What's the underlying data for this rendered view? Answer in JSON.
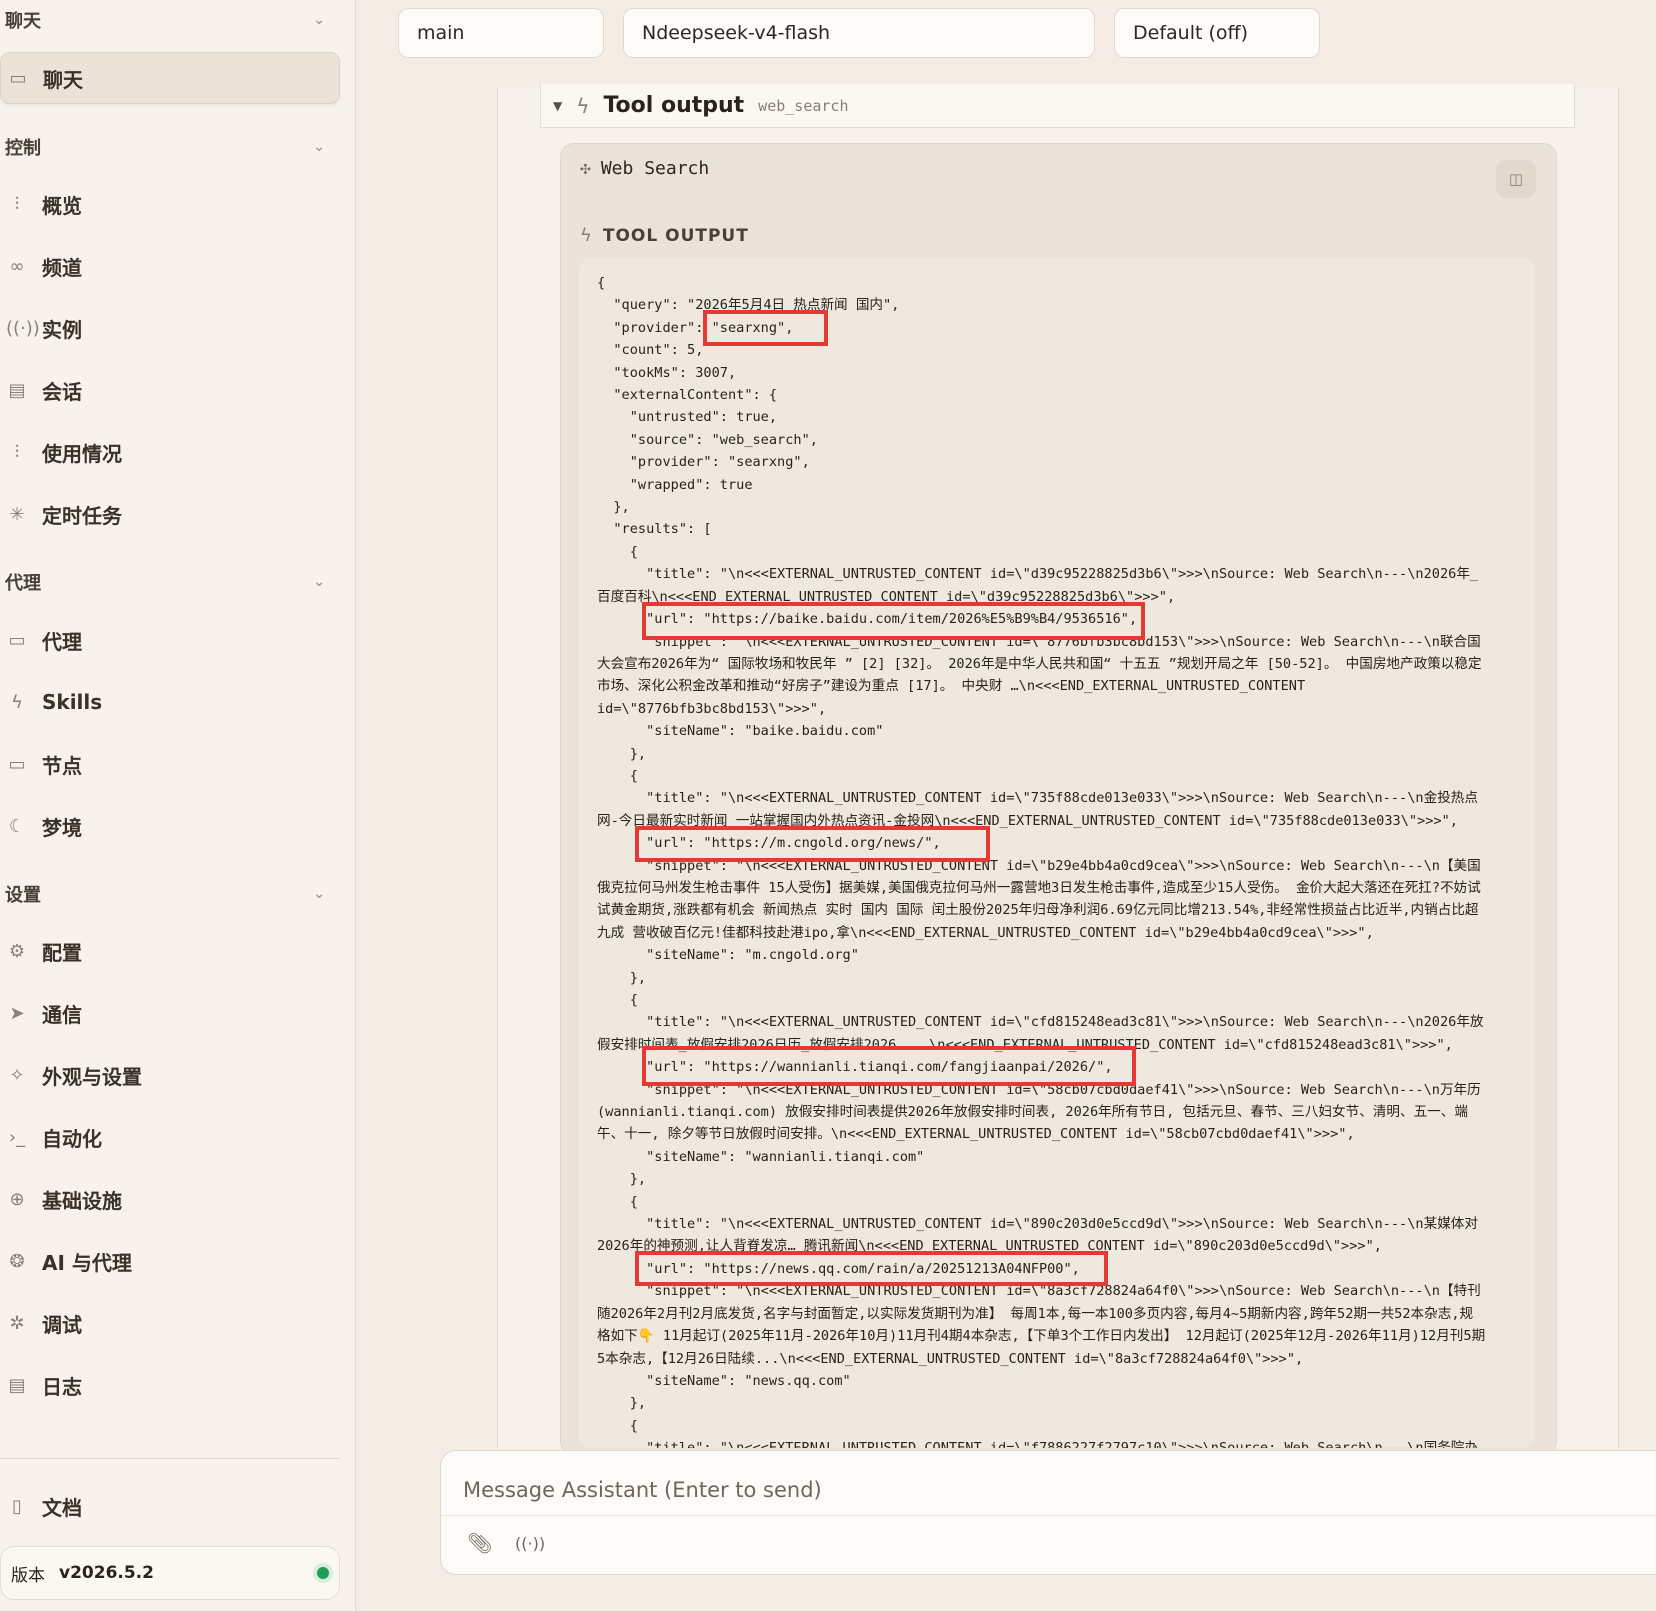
{
  "sidebar": {
    "sections": [
      {
        "title": "聊天"
      },
      {
        "title": "控制"
      },
      {
        "title": "代理"
      },
      {
        "title": "设置"
      }
    ],
    "chat_item": "聊天",
    "control_items": [
      "概览",
      "频道",
      "实例",
      "会话",
      "使用情况",
      "定时任务"
    ],
    "agent_items": [
      "代理",
      "Skills",
      "节点",
      "梦境"
    ],
    "settings_items": [
      "配置",
      "通信",
      "外观与设置",
      "自动化",
      "基础设施",
      "AI 与代理",
      "调试",
      "日志"
    ],
    "docs_item": "文档",
    "version_label": "版本",
    "version_value": "v2026.5.2",
    "status_color": "#1f9d55"
  },
  "top_selectors": {
    "agent": "main",
    "model": "Ndeepseek-v4-flash",
    "thinking": "Default (off)"
  },
  "tool_output": {
    "title": "Tool output",
    "tool_name": "web_search",
    "card_title": "Web Search",
    "section_label": "TOOL OUTPUT",
    "lines": [
      "{",
      "  \"query\": \"2026年5月4日 热点新闻 国内\",",
      "  \"provider\": \"searxng\",",
      "  \"count\": 5,",
      "  \"tookMs\": 3007,",
      "  \"externalContent\": {",
      "    \"untrusted\": true,",
      "    \"source\": \"web_search\",",
      "    \"provider\": \"searxng\",",
      "    \"wrapped\": true",
      "  },",
      "  \"results\": [",
      "    {",
      "      \"title\": \"\\n<<<EXTERNAL_UNTRUSTED_CONTENT id=\\\"d39c95228825d3b6\\\">>>\\nSource: Web Search\\n---\\n2026年_",
      "百度百科\\n<<<END_EXTERNAL_UNTRUSTED_CONTENT id=\\\"d39c95228825d3b6\\\">>>\",",
      "      \"url\": \"https://baike.baidu.com/item/2026%E5%B9%B4/9536516\",",
      "      \"snippet\": \"\\n<<<EXTERNAL_UNTRUSTED_CONTENT id=\\\"8776bfb3bc8bd153\\\">>>\\nSource: Web Search\\n---\\n联合国",
      "大会宣布2026年为“ 国际牧场和牧民年 ” [2] [32]。 2026年是中华人民共和国“ 十五五 ”规划开局之年 [50-52]。 中国房地产政策以稳定",
      "市场、深化公积金改革和推动“好房子”建设为重点 [17]。 中央财 …\\n<<<END_EXTERNAL_UNTRUSTED_CONTENT",
      "id=\\\"8776bfb3bc8bd153\\\">>>\",",
      "      \"siteName\": \"baike.baidu.com\"",
      "    },",
      "    {",
      "      \"title\": \"\\n<<<EXTERNAL_UNTRUSTED_CONTENT id=\\\"735f88cde013e033\\\">>>\\nSource: Web Search\\n---\\n金投热点",
      "网-今日最新实时新闻 一站掌握国内外热点资讯-金投网\\n<<<END_EXTERNAL_UNTRUSTED_CONTENT id=\\\"735f88cde013e033\\\">>>\",",
      "      \"url\": \"https://m.cngold.org/news/\",",
      "      \"snippet\": \"\\n<<<EXTERNAL_UNTRUSTED_CONTENT id=\\\"b29e4bb4a0cd9cea\\\">>>\\nSource: Web Search\\n---\\n【美国",
      "俄克拉何马州发生枪击事件 15人受伤】据美媒,美国俄克拉何马州一露营地3日发生枪击事件,造成至少15人受伤。 金价大起大落还在死扛?不妨试",
      "试黄金期货,涨跌都有机会 新闻热点 实时 国内 国际 闰土股份2025年归母净利润6.69亿元同比增213.54%,非经常性损益占比近半,内销占比超",
      "九成 营收破百亿元!佳都科技赴港ipo,拿\\n<<<END_EXTERNAL_UNTRUSTED_CONTENT id=\\\"b29e4bb4a0cd9cea\\\">>>\",",
      "      \"siteName\": \"m.cngold.org\"",
      "    },",
      "    {",
      "      \"title\": \"\\n<<<EXTERNAL_UNTRUSTED_CONTENT id=\\\"cfd815248ead3c81\\\">>>\\nSource: Web Search\\n---\\n2026年放",
      "假安排时间表_放假安排2026日历_放假安排2026 ...\\n<<<END_EXTERNAL_UNTRUSTED_CONTENT id=\\\"cfd815248ead3c81\\\">>>\",",
      "      \"url\": \"https://wannianli.tianqi.com/fangjiaanpai/2026/\",",
      "      \"snippet\": \"\\n<<<EXTERNAL_UNTRUSTED_CONTENT id=\\\"58cb07cbd0daef41\\\">>>\\nSource: Web Search\\n---\\n万年历",
      "(wannianli.tianqi.com) 放假安排时间表提供2026年放假安排时间表, 2026年所有节日, 包括元旦、春节、三八妇女节、清明、五一、端",
      "午、十一, 除夕等节日放假时间安排。\\n<<<END_EXTERNAL_UNTRUSTED_CONTENT id=\\\"58cb07cbd0daef41\\\">>>\",",
      "      \"siteName\": \"wannianli.tianqi.com\"",
      "    },",
      "    {",
      "      \"title\": \"\\n<<<EXTERNAL_UNTRUSTED_CONTENT id=\\\"890c203d0e5ccd9d\\\">>>\\nSource: Web Search\\n---\\n某媒体对",
      "2026年的神预测,让人背脊发凉… 腾讯新闻\\n<<<END_EXTERNAL_UNTRUSTED_CONTENT id=\\\"890c203d0e5ccd9d\\\">>>\",",
      "      \"url\": \"https://news.qq.com/rain/a/20251213A04NFP00\",",
      "      \"snippet\": \"\\n<<<EXTERNAL_UNTRUSTED_CONTENT id=\\\"8a3cf728824a64f0\\\">>>\\nSource: Web Search\\n---\\n【特刊",
      "随2026年2月刊2月底发货,名字与封面暂定,以实际发货期刊为准】 每周1本,每一本100多页内容,每月4~5期新内容,跨年52期一共52本杂志,规",
      "格如下👇 11月起订(2025年11月-2026年10月)11月刊4期4本杂志,【下单3个工作日内发出】 12月起订(2025年12月-2026年11月)12月刊5期",
      "5本杂志,【12月26日陆续...\\n<<<END_EXTERNAL_UNTRUSTED_CONTENT id=\\\"8a3cf728824a64f0\\\">>>\",",
      "      \"siteName\": \"news.qq.com\"",
      "    },",
      "    {",
      "      \"title\": \"\\n<<<EXTERNAL_UNTRUSTED_CONTENT id=\\\"f7886227f2797c10\\\">>>\\nSource: Web Search\\n---\\n国务院办"
    ]
  },
  "composer": {
    "placeholder": "Message Assistant (Enter to send)"
  },
  "colors": {
    "highlight": "#e53935",
    "background": "#f3ede5"
  }
}
